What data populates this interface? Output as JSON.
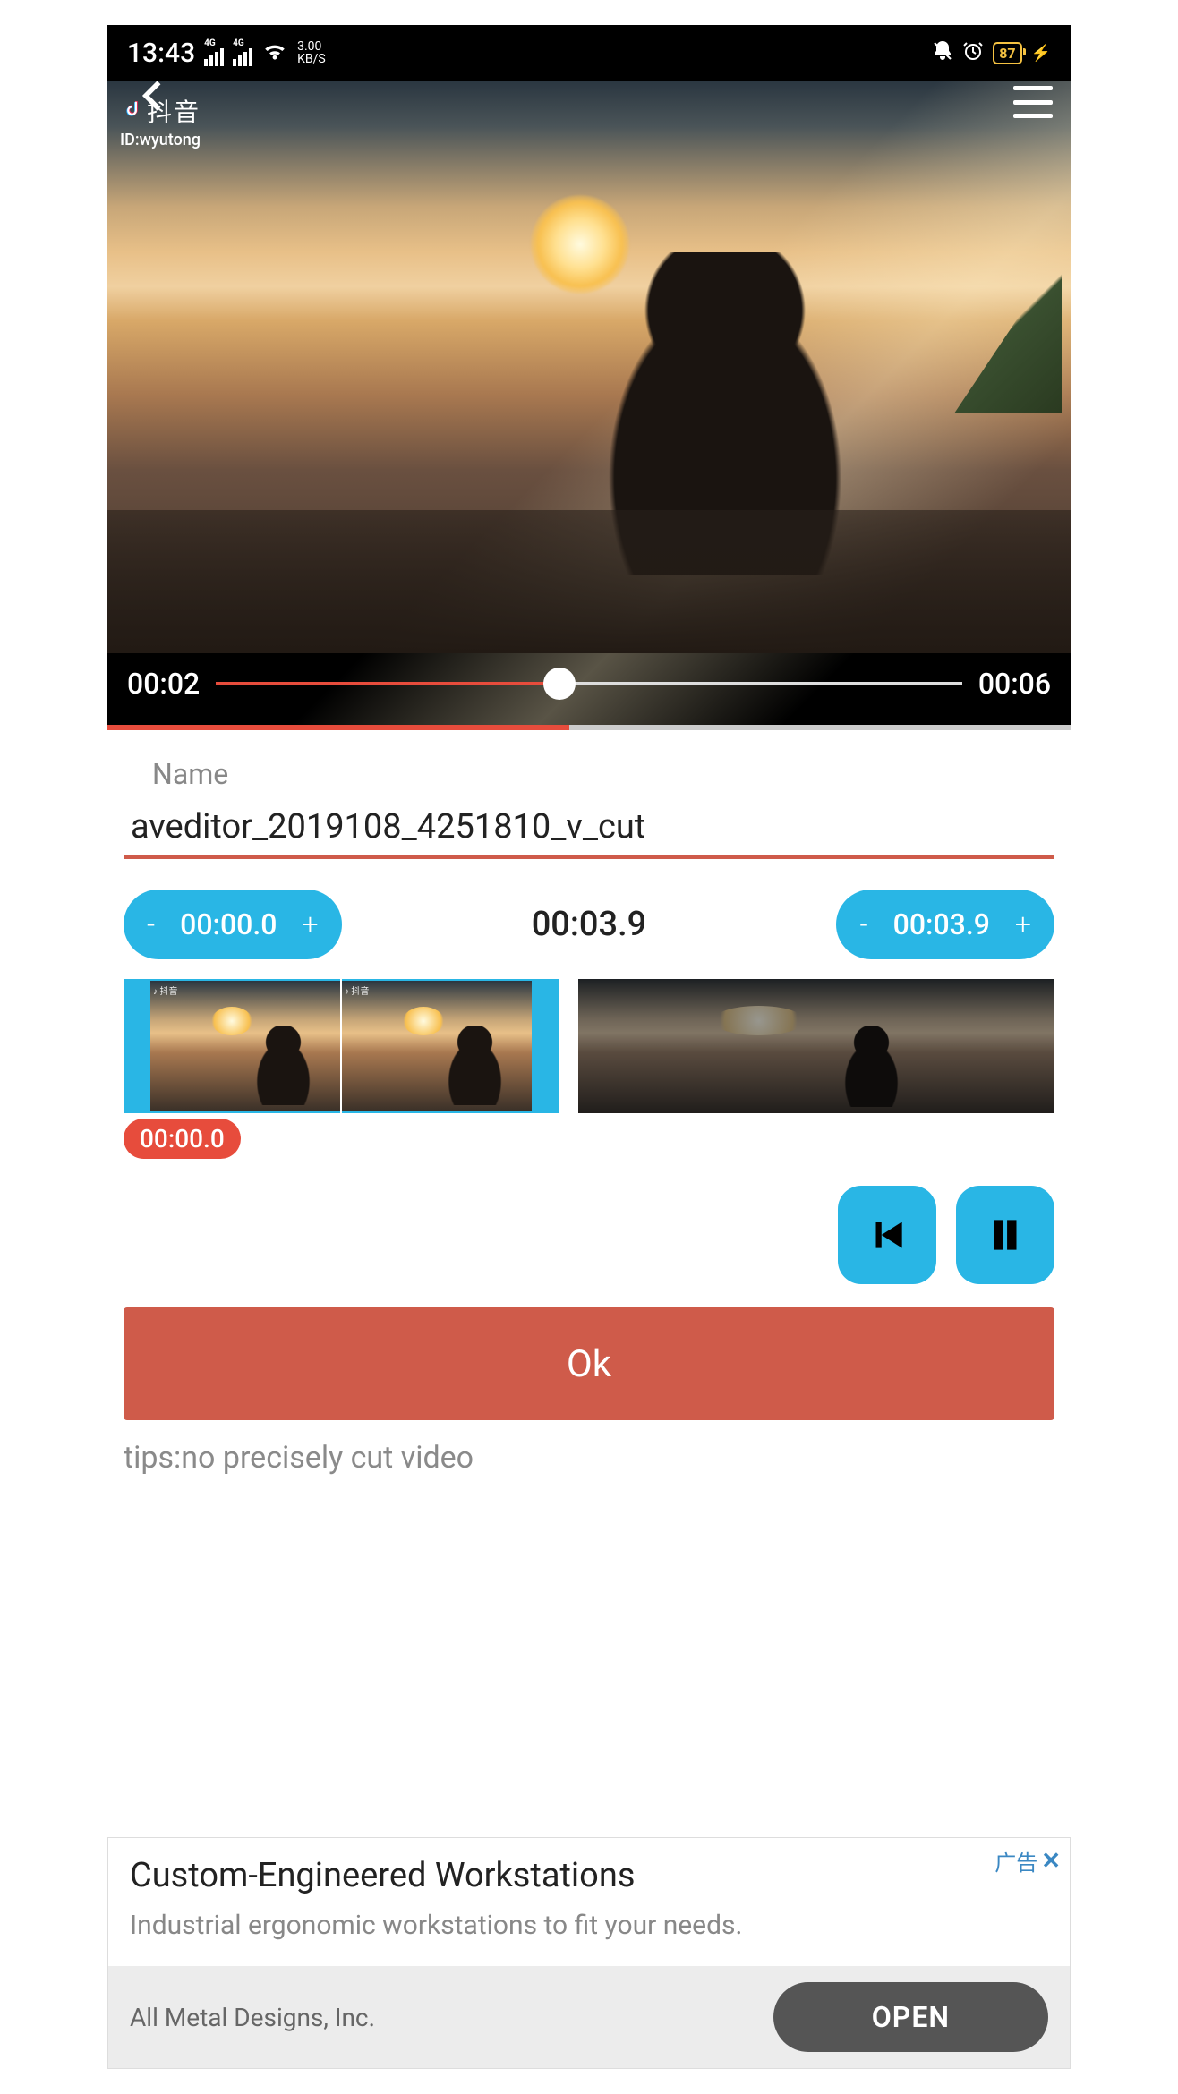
{
  "status": {
    "time": "13:43",
    "net_label": "4G",
    "speed_top": "3.00",
    "speed_bot": "KB/S",
    "battery": "87"
  },
  "watermark": {
    "app": "抖音",
    "id": "ID:wyutong"
  },
  "player": {
    "current": "00:02",
    "duration": "00:06",
    "progress_pct": 46,
    "load_pct": 48
  },
  "form": {
    "name_label": "Name",
    "name_value": "aveditor_2019108_4251810_v_cut"
  },
  "cut": {
    "start_minus": "-",
    "start": "00:00.0",
    "start_plus": "+",
    "mid": "00:03.9",
    "end_minus": "-",
    "end": "00:03.9",
    "end_plus": "+",
    "cursor": "00:00.0"
  },
  "buttons": {
    "ok": "Ok"
  },
  "tips": "tips:no precisely cut video",
  "ad": {
    "tag": "广告",
    "headline": "Custom-Engineered Workstations",
    "sub": "Industrial ergonomic workstations to fit your needs.",
    "company": "All Metal Designs, Inc.",
    "cta": "OPEN"
  }
}
